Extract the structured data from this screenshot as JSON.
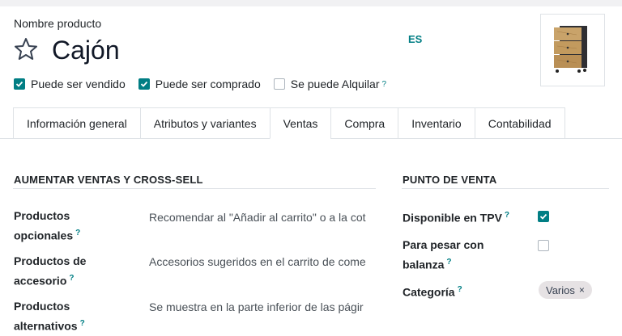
{
  "header": {
    "product_label": "Nombre producto",
    "product_name": "Cajón",
    "language_badge": "ES"
  },
  "flags": [
    {
      "label": "Puede ser vendido",
      "checked": true,
      "help": ""
    },
    {
      "label": "Puede ser comprado",
      "checked": true,
      "help": ""
    },
    {
      "label": "Se puede Alquilar",
      "checked": false,
      "help": "?"
    }
  ],
  "tabs": [
    {
      "label": "Información general",
      "active": false
    },
    {
      "label": "Atributos y variantes",
      "active": false
    },
    {
      "label": "Ventas",
      "active": true
    },
    {
      "label": "Compra",
      "active": false
    },
    {
      "label": "Inventario",
      "active": false
    },
    {
      "label": "Contabilidad",
      "active": false
    }
  ],
  "upsell": {
    "title": "AUMENTAR VENTAS Y CROSS-SELL",
    "fields": [
      {
        "label_line1": "Productos",
        "label_line2": "opcionales",
        "help": "?",
        "placeholder": "Recomendar al \"Añadir al carrito\" o a la cot"
      },
      {
        "label_line1": "Productos de",
        "label_line2": "accesorio",
        "help": "?",
        "placeholder": "Accesorios sugeridos en el carrito de come"
      },
      {
        "label_line1": "Productos",
        "label_line2": "alternativos",
        "help": "?",
        "placeholder": "Se muestra en la parte inferior de las págir"
      }
    ]
  },
  "pos": {
    "title": "PUNTO DE VENTA",
    "available": {
      "label": "Disponible en TPV",
      "help": "?",
      "checked": true
    },
    "weigh": {
      "label_line1": "Para pesar con",
      "label_line2": "balanza",
      "help": "?",
      "checked": false
    },
    "category": {
      "label": "Categoría",
      "help": "?",
      "tag": "Varios",
      "remove": "×"
    }
  },
  "colors": {
    "accent": "#017e84",
    "tag_bg": "#e6e2e4",
    "border": "#dee2e6"
  },
  "icons": {
    "favorite": "star-outline-icon",
    "check": "check-icon",
    "remove": "close-icon"
  }
}
